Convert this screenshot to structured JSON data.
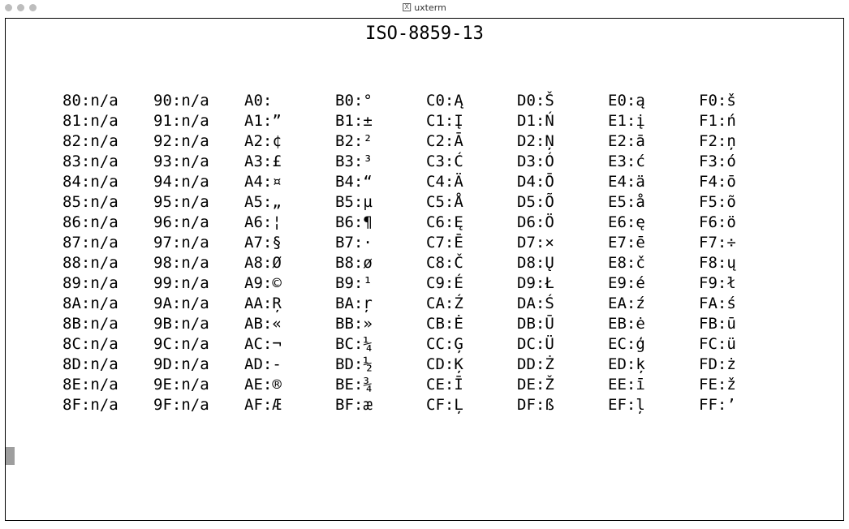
{
  "window": {
    "title": "uxterm",
    "icon_label": "X"
  },
  "heading": "ISO-8859-13",
  "chart_data": {
    "type": "table",
    "title": "ISO-8859-13",
    "encoding": "ISO-8859-13",
    "range_hex": [
      "80",
      "FF"
    ],
    "columns": [
      [
        {
          "code": "80",
          "glyph": "n/a"
        },
        {
          "code": "81",
          "glyph": "n/a"
        },
        {
          "code": "82",
          "glyph": "n/a"
        },
        {
          "code": "83",
          "glyph": "n/a"
        },
        {
          "code": "84",
          "glyph": "n/a"
        },
        {
          "code": "85",
          "glyph": "n/a"
        },
        {
          "code": "86",
          "glyph": "n/a"
        },
        {
          "code": "87",
          "glyph": "n/a"
        },
        {
          "code": "88",
          "glyph": "n/a"
        },
        {
          "code": "89",
          "glyph": "n/a"
        },
        {
          "code": "8A",
          "glyph": "n/a"
        },
        {
          "code": "8B",
          "glyph": "n/a"
        },
        {
          "code": "8C",
          "glyph": "n/a"
        },
        {
          "code": "8D",
          "glyph": "n/a"
        },
        {
          "code": "8E",
          "glyph": "n/a"
        },
        {
          "code": "8F",
          "glyph": "n/a"
        }
      ],
      [
        {
          "code": "90",
          "glyph": "n/a"
        },
        {
          "code": "91",
          "glyph": "n/a"
        },
        {
          "code": "92",
          "glyph": "n/a"
        },
        {
          "code": "93",
          "glyph": "n/a"
        },
        {
          "code": "94",
          "glyph": "n/a"
        },
        {
          "code": "95",
          "glyph": "n/a"
        },
        {
          "code": "96",
          "glyph": "n/a"
        },
        {
          "code": "97",
          "glyph": "n/a"
        },
        {
          "code": "98",
          "glyph": "n/a"
        },
        {
          "code": "99",
          "glyph": "n/a"
        },
        {
          "code": "9A",
          "glyph": "n/a"
        },
        {
          "code": "9B",
          "glyph": "n/a"
        },
        {
          "code": "9C",
          "glyph": "n/a"
        },
        {
          "code": "9D",
          "glyph": "n/a"
        },
        {
          "code": "9E",
          "glyph": "n/a"
        },
        {
          "code": "9F",
          "glyph": "n/a"
        }
      ],
      [
        {
          "code": "A0",
          "glyph": " "
        },
        {
          "code": "A1",
          "glyph": "”"
        },
        {
          "code": "A2",
          "glyph": "¢"
        },
        {
          "code": "A3",
          "glyph": "£"
        },
        {
          "code": "A4",
          "glyph": "¤"
        },
        {
          "code": "A5",
          "glyph": "„"
        },
        {
          "code": "A6",
          "glyph": "¦"
        },
        {
          "code": "A7",
          "glyph": "§"
        },
        {
          "code": "A8",
          "glyph": "Ø"
        },
        {
          "code": "A9",
          "glyph": "©"
        },
        {
          "code": "AA",
          "glyph": "Ŗ"
        },
        {
          "code": "AB",
          "glyph": "«"
        },
        {
          "code": "AC",
          "glyph": "¬"
        },
        {
          "code": "AD",
          "glyph": "-"
        },
        {
          "code": "AE",
          "glyph": "®"
        },
        {
          "code": "AF",
          "glyph": "Æ"
        }
      ],
      [
        {
          "code": "B0",
          "glyph": "°"
        },
        {
          "code": "B1",
          "glyph": "±"
        },
        {
          "code": "B2",
          "glyph": "²"
        },
        {
          "code": "B3",
          "glyph": "³"
        },
        {
          "code": "B4",
          "glyph": "“"
        },
        {
          "code": "B5",
          "glyph": "µ"
        },
        {
          "code": "B6",
          "glyph": "¶"
        },
        {
          "code": "B7",
          "glyph": "·"
        },
        {
          "code": "B8",
          "glyph": "ø"
        },
        {
          "code": "B9",
          "glyph": "¹"
        },
        {
          "code": "BA",
          "glyph": "ŗ"
        },
        {
          "code": "BB",
          "glyph": "»"
        },
        {
          "code": "BC",
          "glyph": "¼"
        },
        {
          "code": "BD",
          "glyph": "½"
        },
        {
          "code": "BE",
          "glyph": "¾"
        },
        {
          "code": "BF",
          "glyph": "æ"
        }
      ],
      [
        {
          "code": "C0",
          "glyph": "Ą"
        },
        {
          "code": "C1",
          "glyph": "Į"
        },
        {
          "code": "C2",
          "glyph": "Ā"
        },
        {
          "code": "C3",
          "glyph": "Ć"
        },
        {
          "code": "C4",
          "glyph": "Ä"
        },
        {
          "code": "C5",
          "glyph": "Å"
        },
        {
          "code": "C6",
          "glyph": "Ę"
        },
        {
          "code": "C7",
          "glyph": "Ē"
        },
        {
          "code": "C8",
          "glyph": "Č"
        },
        {
          "code": "C9",
          "glyph": "É"
        },
        {
          "code": "CA",
          "glyph": "Ź"
        },
        {
          "code": "CB",
          "glyph": "Ė"
        },
        {
          "code": "CC",
          "glyph": "Ģ"
        },
        {
          "code": "CD",
          "glyph": "Ķ"
        },
        {
          "code": "CE",
          "glyph": "Ī"
        },
        {
          "code": "CF",
          "glyph": "Ļ"
        }
      ],
      [
        {
          "code": "D0",
          "glyph": "Š"
        },
        {
          "code": "D1",
          "glyph": "Ń"
        },
        {
          "code": "D2",
          "glyph": "Ņ"
        },
        {
          "code": "D3",
          "glyph": "Ó"
        },
        {
          "code": "D4",
          "glyph": "Ō"
        },
        {
          "code": "D5",
          "glyph": "Õ"
        },
        {
          "code": "D6",
          "glyph": "Ö"
        },
        {
          "code": "D7",
          "glyph": "×"
        },
        {
          "code": "D8",
          "glyph": "Ų"
        },
        {
          "code": "D9",
          "glyph": "Ł"
        },
        {
          "code": "DA",
          "glyph": "Ś"
        },
        {
          "code": "DB",
          "glyph": "Ū"
        },
        {
          "code": "DC",
          "glyph": "Ü"
        },
        {
          "code": "DD",
          "glyph": "Ż"
        },
        {
          "code": "DE",
          "glyph": "Ž"
        },
        {
          "code": "DF",
          "glyph": "ß"
        }
      ],
      [
        {
          "code": "E0",
          "glyph": "ą"
        },
        {
          "code": "E1",
          "glyph": "į"
        },
        {
          "code": "E2",
          "glyph": "ā"
        },
        {
          "code": "E3",
          "glyph": "ć"
        },
        {
          "code": "E4",
          "glyph": "ä"
        },
        {
          "code": "E5",
          "glyph": "å"
        },
        {
          "code": "E6",
          "glyph": "ę"
        },
        {
          "code": "E7",
          "glyph": "ē"
        },
        {
          "code": "E8",
          "glyph": "č"
        },
        {
          "code": "E9",
          "glyph": "é"
        },
        {
          "code": "EA",
          "glyph": "ź"
        },
        {
          "code": "EB",
          "glyph": "ė"
        },
        {
          "code": "EC",
          "glyph": "ģ"
        },
        {
          "code": "ED",
          "glyph": "ķ"
        },
        {
          "code": "EE",
          "glyph": "ī"
        },
        {
          "code": "EF",
          "glyph": "ļ"
        }
      ],
      [
        {
          "code": "F0",
          "glyph": "š"
        },
        {
          "code": "F1",
          "glyph": "ń"
        },
        {
          "code": "F2",
          "glyph": "ņ"
        },
        {
          "code": "F3",
          "glyph": "ó"
        },
        {
          "code": "F4",
          "glyph": "ō"
        },
        {
          "code": "F5",
          "glyph": "õ"
        },
        {
          "code": "F6",
          "glyph": "ö"
        },
        {
          "code": "F7",
          "glyph": "÷"
        },
        {
          "code": "F8",
          "glyph": "ų"
        },
        {
          "code": "F9",
          "glyph": "ł"
        },
        {
          "code": "FA",
          "glyph": "ś"
        },
        {
          "code": "FB",
          "glyph": "ū"
        },
        {
          "code": "FC",
          "glyph": "ü"
        },
        {
          "code": "FD",
          "glyph": "ż"
        },
        {
          "code": "FE",
          "glyph": "ž"
        },
        {
          "code": "FF",
          "glyph": "’"
        }
      ]
    ]
  }
}
